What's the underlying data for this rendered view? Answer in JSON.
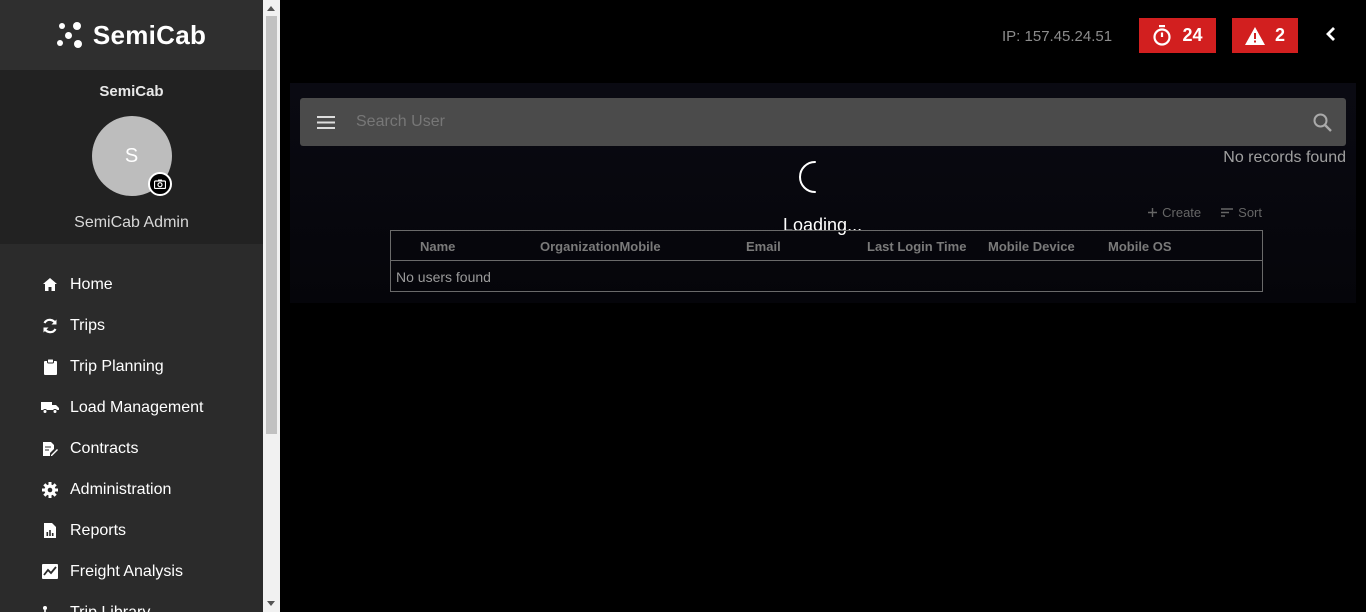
{
  "brand": {
    "name": "SemiCab"
  },
  "profile": {
    "org": "SemiCab",
    "initial": "S",
    "user": "SemiCab Admin"
  },
  "nav": [
    {
      "label": "Home",
      "icon": "home-icon"
    },
    {
      "label": "Trips",
      "icon": "refresh-icon"
    },
    {
      "label": "Trip Planning",
      "icon": "clipboard-icon"
    },
    {
      "label": "Load Management",
      "icon": "truck-icon"
    },
    {
      "label": "Contracts",
      "icon": "contract-icon"
    },
    {
      "label": "Administration",
      "icon": "gear-icon"
    },
    {
      "label": "Reports",
      "icon": "report-icon"
    },
    {
      "label": "Freight Analysis",
      "icon": "chart-icon"
    },
    {
      "label": "Trip Library",
      "icon": "route-icon"
    }
  ],
  "header": {
    "ip": "IP: 157.45.24.51",
    "timer_count": "24",
    "alert_count": "2"
  },
  "search": {
    "placeholder": "Search User"
  },
  "status": {
    "no_records": "No records found",
    "loading": "Loading..."
  },
  "actions": {
    "create": "Create",
    "sort": "Sort"
  },
  "table": {
    "columns": [
      "Name",
      "OrganizationMobile",
      "Email",
      "Last Login Time",
      "Mobile Device",
      "Mobile OS"
    ],
    "empty": "No users found"
  },
  "colors": {
    "accent": "#d21f1f",
    "sidebar": "#2b2b2b",
    "background": "#000000"
  }
}
